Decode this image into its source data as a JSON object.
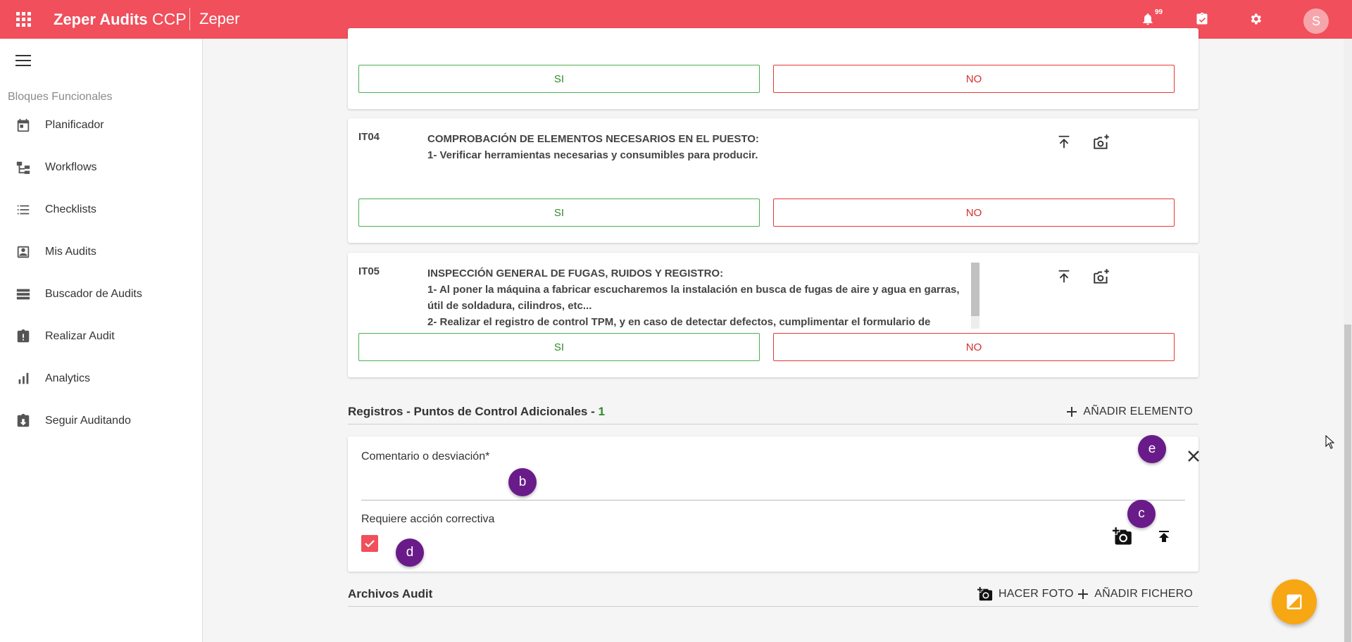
{
  "header": {
    "app_title_bold": "Zeper Audits",
    "app_title_suffix": " CCP",
    "org_name": "Zeper",
    "notification_count": "99",
    "avatar_initial": "S",
    "icons": [
      "apps-icon",
      "bell-icon",
      "clipboard-icon",
      "gear-icon"
    ]
  },
  "sidebar": {
    "section_label": "Bloques Funcionales",
    "items": [
      {
        "label": "Planificador",
        "icon": "calendar-icon"
      },
      {
        "label": "Workflows",
        "icon": "workflow-icon"
      },
      {
        "label": "Checklists",
        "icon": "list-icon"
      },
      {
        "label": "Mis Audits",
        "icon": "person-box-icon"
      },
      {
        "label": "Buscador de Audits",
        "icon": "stack-icon"
      },
      {
        "label": "Realizar Audit",
        "icon": "clipboard-alert-icon"
      },
      {
        "label": "Analytics",
        "icon": "bar-chart-icon"
      },
      {
        "label": "Seguir Auditando",
        "icon": "clipboard-arrow-icon"
      }
    ]
  },
  "items": [
    {
      "yes_label": "SI",
      "no_label": "NO"
    },
    {
      "code": "IT04",
      "lines": [
        "COMPROBACIÓN  DE ELEMENTOS NECESARIOS EN EL PUESTO:",
        "1- Verificar herramientas necesarias y consumibles para producir."
      ],
      "yes_label": "SI",
      "no_label": "NO"
    },
    {
      "code": "IT05",
      "lines": [
        "INSPECCIÓN GENERAL DE FUGAS, RUIDOS Y REGISTRO:",
        "1- Al poner la máquina a fabricar escucharemos la instalación en busca de fugas de aire y agua en garras,",
        "útil de soldadura, cilindros, etc...",
        "2- Realizar el registro de control TPM, y en caso de detectar defectos, cumplimentar el formulario de"
      ],
      "yes_label": "SI",
      "no_label": "NO"
    }
  ],
  "registros": {
    "title": "Registros - Puntos de Control Adicionales - ",
    "count": "1",
    "add_label": "AÑADIR ELEMENTO",
    "comment_label": "Comentario o desviación*",
    "comment_value": "",
    "corrective_label": "Requiere acción correctiva",
    "corrective_checked": true
  },
  "markers": {
    "b": "b",
    "c": "c",
    "d": "d",
    "e": "e"
  },
  "archivos": {
    "title": "Archivos Audit",
    "photo_label": "HACER FOTO",
    "file_label": "AÑADIR FICHERO"
  }
}
